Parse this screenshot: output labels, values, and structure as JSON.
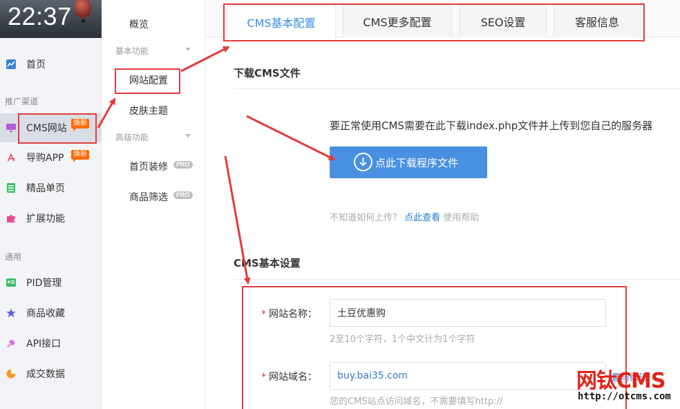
{
  "clock": {
    "time": "22:37"
  },
  "sidebar": {
    "home": "首页",
    "group_promo": "推广渠道",
    "items_promo": [
      {
        "label": "CMS网站",
        "badge": "焕新"
      },
      {
        "label": "导购APP",
        "badge": "焕新"
      },
      {
        "label": "精品单页"
      },
      {
        "label": "扩展功能"
      }
    ],
    "group_general": "通用",
    "items_general": [
      {
        "label": "PID管理"
      },
      {
        "label": "商品收藏"
      },
      {
        "label": "API接口"
      },
      {
        "label": "成交数据"
      }
    ]
  },
  "submenu": {
    "overview": "概览",
    "group_basic": "基本功能",
    "site_config": "网站配置",
    "skin": "皮肤主题",
    "group_advanced": "高级功能",
    "home_decor": "首页装修",
    "goods_filter": "商品筛选",
    "pro_label": "PRO"
  },
  "tabs": [
    "CMS基本配置",
    "CMS更多配置",
    "SEO设置",
    "客服信息"
  ],
  "download": {
    "title": "下载CMS文件",
    "desc": "要正常使用CMS需要在此下载index.php文件并上传到您自己的服务器",
    "button": "点此下载程序文件",
    "help_prefix": "不知道如何上传？",
    "help_link": "点此查看",
    "help_suffix": "使用帮助"
  },
  "basic": {
    "title": "CMS基本设置",
    "site_name_label": "网站名称：",
    "site_name_value": "土豆优惠购",
    "site_name_hint": "2至10个字符，1个中文计为1个字符",
    "domain_label": "网站域名：",
    "domain_value": "buy.bai35.com",
    "domain_hint": "您的CMS站点访问域名，不需要填写http://",
    "side_note": "置与绑码"
  },
  "watermark": {
    "brand": "网钛CMS",
    "url": "http://otcms.com"
  },
  "colors": {
    "accent": "#4a90e2",
    "annotation": "#e23b3b",
    "badge": "#ff6a00"
  }
}
